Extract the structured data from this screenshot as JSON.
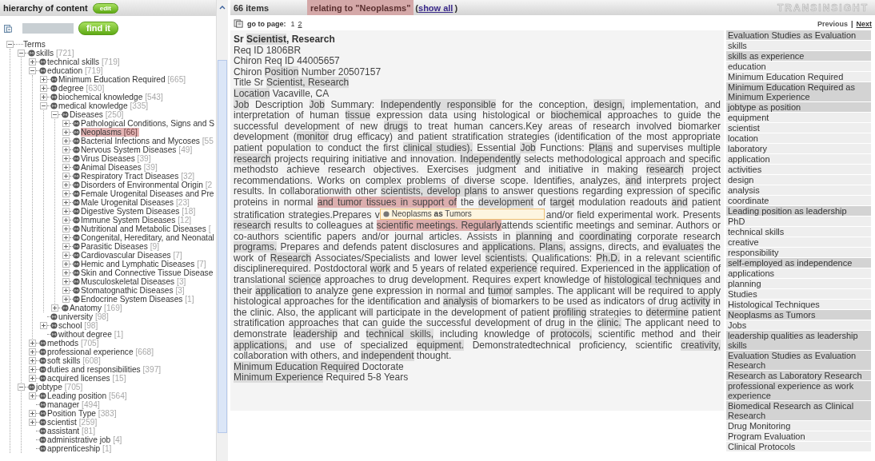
{
  "tree_panel": {
    "title": "hierarchy of content",
    "edit_button": "edit",
    "find_button": "find it"
  },
  "tree": {
    "root": {
      "label": "Terms",
      "expanded": true,
      "children": [
        {
          "label": "skills",
          "count": "[721]",
          "expanded": true,
          "selected": false,
          "children": [
            {
              "label": "technical skills",
              "count": "[719]",
              "expanded": false,
              "selected": false
            },
            {
              "label": "education",
              "count": "[719]",
              "expanded": true,
              "selected": false,
              "children": [
                {
                  "label": "Minimum Education Required",
                  "count": "[665]",
                  "expanded": false,
                  "selected": false
                },
                {
                  "label": "degree",
                  "count": "[630]",
                  "expanded": false,
                  "selected": false
                },
                {
                  "label": "biochemical knowledge",
                  "count": "[543]",
                  "expanded": false,
                  "selected": false
                },
                {
                  "label": "medical knowledge",
                  "count": "[335]",
                  "expanded": true,
                  "selected": false,
                  "children": [
                    {
                      "label": "Diseases",
                      "count": "[250]",
                      "expanded": true,
                      "selected": false,
                      "children": [
                        {
                          "label": "Pathological Conditions, Signs and S",
                          "expanded": false,
                          "selected": false
                        },
                        {
                          "label": "Neoplasms",
                          "count": "[66]",
                          "expanded": false,
                          "selected": true
                        },
                        {
                          "label": "Bacterial Infections and Mycoses",
                          "count": "[55",
                          "expanded": false,
                          "selected": false
                        },
                        {
                          "label": "Nervous System Diseases",
                          "count": "[49]",
                          "expanded": false,
                          "selected": false
                        },
                        {
                          "label": "Virus Diseases",
                          "count": "[39]",
                          "expanded": false,
                          "selected": false
                        },
                        {
                          "label": "Animal Diseases",
                          "count": "[39]",
                          "expanded": false,
                          "selected": false
                        },
                        {
                          "label": "Respiratory Tract Diseases",
                          "count": "[32]",
                          "expanded": false,
                          "selected": false
                        },
                        {
                          "label": "Disorders of Environmental Origin",
                          "count": "[2",
                          "expanded": false,
                          "selected": false
                        },
                        {
                          "label": "Female Urogenital Diseases and Pre",
                          "expanded": false,
                          "selected": false
                        },
                        {
                          "label": "Male Urogenital Diseases",
                          "count": "[23]",
                          "expanded": false,
                          "selected": false
                        },
                        {
                          "label": "Digestive System Diseases",
                          "count": "[18]",
                          "expanded": false,
                          "selected": false
                        },
                        {
                          "label": "Immune System Diseases",
                          "count": "[12]",
                          "expanded": false,
                          "selected": false
                        },
                        {
                          "label": "Nutritional and Metabolic Diseases",
                          "count": "[",
                          "expanded": false,
                          "selected": false
                        },
                        {
                          "label": "Congenital, Hereditary, and Neonatal",
                          "expanded": false,
                          "selected": false
                        },
                        {
                          "label": "Parasitic Diseases",
                          "count": "[9]",
                          "expanded": false,
                          "selected": false
                        },
                        {
                          "label": "Cardiovascular Diseases",
                          "count": "[7]",
                          "expanded": false,
                          "selected": false
                        },
                        {
                          "label": "Hemic and Lymphatic Diseases",
                          "count": "[7]",
                          "expanded": false,
                          "selected": false
                        },
                        {
                          "label": "Skin and Connective Tissue Disease",
                          "expanded": false,
                          "selected": false
                        },
                        {
                          "label": "Musculoskeletal Diseases",
                          "count": "[3]",
                          "expanded": false,
                          "selected": false
                        },
                        {
                          "label": "Stomatognathic Diseases",
                          "count": "[3]",
                          "expanded": false,
                          "selected": false
                        },
                        {
                          "label": "Endocrine System Diseases",
                          "count": "[1]",
                          "expanded": false,
                          "selected": false
                        }
                      ]
                    },
                    {
                      "label": "Anatomy",
                      "count": "[169]",
                      "expanded": false,
                      "selected": false
                    }
                  ]
                },
                {
                  "label": "university",
                  "count": "[98]",
                  "selected": false
                },
                {
                  "label": "school",
                  "count": "[98]",
                  "expanded": false,
                  "selected": false
                },
                {
                  "label": "without degree",
                  "count": "[1]",
                  "selected": false
                }
              ]
            },
            {
              "label": "methods",
              "count": "[705]",
              "expanded": false,
              "selected": false
            },
            {
              "label": "professional experience",
              "count": "[668]",
              "expanded": false,
              "selected": false
            },
            {
              "label": "soft skills",
              "count": "[608]",
              "expanded": false,
              "selected": false
            },
            {
              "label": "duties and responsibilities",
              "count": "[397]",
              "expanded": false,
              "selected": false
            },
            {
              "label": "acquired licenses",
              "count": "[15]",
              "expanded": false,
              "selected": false
            }
          ]
        },
        {
          "label": "jobtype",
          "count": "[705]",
          "expanded": true,
          "selected": false,
          "children": [
            {
              "label": "Leading position",
              "count": "[564]",
              "expanded": false,
              "selected": false
            },
            {
              "label": "manager",
              "count": "[494]",
              "selected": false
            },
            {
              "label": "Position Type",
              "count": "[383]",
              "expanded": false,
              "selected": false
            },
            {
              "label": "scientist",
              "count": "[259]",
              "expanded": false,
              "selected": false
            },
            {
              "label": "assistant",
              "count": "[81]",
              "selected": false
            },
            {
              "label": "administrative job",
              "count": "[4]",
              "selected": false
            },
            {
              "label": "apprenticeship",
              "count": "[1]",
              "selected": false
            }
          ]
        }
      ]
    }
  },
  "results": {
    "count": "66 items",
    "filter": "relating to \"Neoplasms\"",
    "show_all_open": "(",
    "show_all": "show all",
    "show_all_close": ")",
    "logo": "TRANSINSIGHT"
  },
  "pager": {
    "label": "go to page:",
    "pages": [
      {
        "label": "1",
        "selected": true
      },
      {
        "label": "2",
        "selected": false
      }
    ],
    "previous": {
      "label": "Previous",
      "disabled": true
    },
    "separator": "|",
    "next": {
      "label": "Next",
      "disabled": false
    }
  },
  "document": {
    "lines": [
      {
        "kind": "title",
        "segments": [
          {
            "text": "Sr ",
            "kind": "plain"
          },
          {
            "text": "Scientist",
            "kind": "term"
          },
          {
            "text": ", Research",
            "kind": "plain"
          }
        ]
      },
      {
        "kind": "text",
        "segments": [
          {
            "text": "Req ID 1806BR",
            "kind": "plain"
          }
        ]
      },
      {
        "kind": "text",
        "segments": [
          {
            "text": "Chiron Req ID 44005657",
            "kind": "plain"
          }
        ]
      },
      {
        "kind": "text",
        "segments": [
          {
            "text": "Chiron ",
            "kind": "plain"
          },
          {
            "text": "Position",
            "kind": "term"
          },
          {
            "text": " Number 20507157",
            "kind": "plain"
          }
        ]
      },
      {
        "kind": "text",
        "segments": [
          {
            "text": "Title Sr ",
            "kind": "plain"
          },
          {
            "text": "Scientist, ",
            "kind": "term"
          },
          {
            "text": "Research",
            "kind": "term"
          }
        ]
      },
      {
        "kind": "text",
        "segments": [
          {
            "text": "Location",
            "kind": "term"
          },
          {
            "text": " Vacaville, CA",
            "kind": "plain"
          }
        ]
      }
    ],
    "description": [
      {
        "text": "Job",
        "kind": "term"
      },
      {
        "text": " Description ",
        "kind": "plain"
      },
      {
        "text": "Job",
        "kind": "term"
      },
      {
        "text": " Summary: ",
        "kind": "plain"
      },
      {
        "text": "Independently ",
        "kind": "term"
      },
      {
        "text": "responsible",
        "kind": "term"
      },
      {
        "text": " for the conception, ",
        "kind": "plain"
      },
      {
        "text": "design,",
        "kind": "term"
      },
      {
        "text": " implementation, and interpretation of human ",
        "kind": "plain"
      },
      {
        "text": "tissue",
        "kind": "term"
      },
      {
        "text": " expression data using histological or ",
        "kind": "plain"
      },
      {
        "text": "biochemical",
        "kind": "term"
      },
      {
        "text": " approaches to guide the successful development of new ",
        "kind": "plain"
      },
      {
        "text": "drugs",
        "kind": "term"
      },
      {
        "text": " to treat human cancers.Key areas of research involved biomarker development (",
        "kind": "plain"
      },
      {
        "text": "monitor",
        "kind": "term"
      },
      {
        "text": " drug efficacy) and patient stratification strategies (identification of the most appropriate patient population to conduct the first ",
        "kind": "plain"
      },
      {
        "text": "clinical studies).",
        "kind": "term"
      },
      {
        "text": " Essential ",
        "kind": "plain"
      },
      {
        "text": "Job",
        "kind": "term"
      },
      {
        "text": " Functions: ",
        "kind": "plain"
      },
      {
        "text": "Plans",
        "kind": "term"
      },
      {
        "text": " and supervises multiple ",
        "kind": "plain"
      },
      {
        "text": "research",
        "kind": "term"
      },
      {
        "text": " projects requiring initiative and innovation. ",
        "kind": "plain"
      },
      {
        "text": "Independently",
        "kind": "term"
      },
      {
        "text": " selects methodological approach and specific methodsto achieve research objectives. Exercises judgment and initiative in making ",
        "kind": "plain"
      },
      {
        "text": "research",
        "kind": "term"
      },
      {
        "text": " project recommendations. Works on complex problems of diverse scope. Identifies, analyzes, ",
        "kind": "plain"
      },
      {
        "text": "and",
        "kind": "term"
      },
      {
        "text": " interprets project results. In collaborationwith other ",
        "kind": "plain"
      },
      {
        "text": "scientists, ",
        "kind": "term"
      },
      {
        "text": "develop ",
        "kind": "term"
      },
      {
        "text": "plans",
        "kind": "term"
      },
      {
        "text": " to answer questions regarding expression of specific proteins in normal ",
        "kind": "plain"
      },
      {
        "text": "and tumor tissues in support of",
        "kind": "hit"
      },
      {
        "text": " the ",
        "kind": "plain"
      },
      {
        "text": "development",
        "kind": "term"
      },
      {
        "text": " of ",
        "kind": "plain"
      },
      {
        "text": "target",
        "kind": "term"
      },
      {
        "text": " modulation readouts ",
        "kind": "plain"
      },
      {
        "text": "and",
        "kind": "term"
      },
      {
        "text": " patient stratification strategies.Prepares v",
        "kind": "plain"
      }
    ],
    "tooltip": {
      "text": "Neoplasms **as** Tumors"
    },
    "description_rest": [
      {
        "text": "and/or field experimental work. Presents ",
        "kind": "plain"
      },
      {
        "text": "research",
        "kind": "term"
      },
      {
        "text": " results to colleagues at ",
        "kind": "plain"
      },
      {
        "text": "scientific meetings. Regularly",
        "kind": "hit"
      },
      {
        "text": "attends scientific meetings and seminar. Authors or co-authors scientific papers and/or journal articles. Assists in ",
        "kind": "plain"
      },
      {
        "text": "planning",
        "kind": "term"
      },
      {
        "text": " and ",
        "kind": "plain"
      },
      {
        "text": "coordinating",
        "kind": "term"
      },
      {
        "text": " corporate research ",
        "kind": "plain"
      },
      {
        "text": "programs.",
        "kind": "term"
      },
      {
        "text": " Prepares and defends patent disclosures and ",
        "kind": "plain"
      },
      {
        "text": "applications. ",
        "kind": "term"
      },
      {
        "text": "Plans,",
        "kind": "term"
      },
      {
        "text": " assigns, directs, and ",
        "kind": "plain"
      },
      {
        "text": "evaluates",
        "kind": "term"
      },
      {
        "text": " the work of ",
        "kind": "plain"
      },
      {
        "text": "Research",
        "kind": "term"
      },
      {
        "text": " Associates/Specialists and lower level ",
        "kind": "plain"
      },
      {
        "text": "scientists.",
        "kind": "term"
      },
      {
        "text": " Qualifications: ",
        "kind": "plain"
      },
      {
        "text": "Ph.D.",
        "kind": "term"
      },
      {
        "text": " in a relevant scientific disciplinerequired. Postdoctoral ",
        "kind": "plain"
      },
      {
        "text": "work",
        "kind": "term"
      },
      {
        "text": " and 5 years of related ",
        "kind": "plain"
      },
      {
        "text": "experience",
        "kind": "term"
      },
      {
        "text": " required. Experienced in the ",
        "kind": "plain"
      },
      {
        "text": "application",
        "kind": "term"
      },
      {
        "text": " of translational ",
        "kind": "plain"
      },
      {
        "text": "science",
        "kind": "term"
      },
      {
        "text": " approaches to drug development. Requires expert knowledge of ",
        "kind": "plain"
      },
      {
        "text": "histological techniques",
        "kind": "term"
      },
      {
        "text": " and their ",
        "kind": "plain"
      },
      {
        "text": "application",
        "kind": "term"
      },
      {
        "text": " to analyze gene expression in normal and ",
        "kind": "plain"
      },
      {
        "text": "tumor",
        "kind": "term"
      },
      {
        "text": " samples. The applicant will be required to apply histological approaches for the identification and ",
        "kind": "plain"
      },
      {
        "text": "analysis",
        "kind": "term"
      },
      {
        "text": " of biomarkers to be used as indicators of drug ",
        "kind": "plain"
      },
      {
        "text": "activity",
        "kind": "term"
      },
      {
        "text": " in the clinic. Also, the applicant will participate in the development of patient ",
        "kind": "plain"
      },
      {
        "text": "profiling",
        "kind": "term"
      },
      {
        "text": " strategies to ",
        "kind": "plain"
      },
      {
        "text": "determine",
        "kind": "term"
      },
      {
        "text": " patient stratification approaches that can guide the successful development of drug in the ",
        "kind": "plain"
      },
      {
        "text": "clinic.",
        "kind": "term"
      },
      {
        "text": " The applicant need to demonstrate ",
        "kind": "plain"
      },
      {
        "text": "leadership",
        "kind": "term"
      },
      {
        "text": " and ",
        "kind": "plain"
      },
      {
        "text": "technical ",
        "kind": "term"
      },
      {
        "text": "skills,",
        "kind": "term"
      },
      {
        "text": " including knowledge of ",
        "kind": "plain"
      },
      {
        "text": "protocols,",
        "kind": "term"
      },
      {
        "text": " scientific method and their ",
        "kind": "plain"
      },
      {
        "text": "applications,",
        "kind": "term"
      },
      {
        "text": " and use of specialized ",
        "kind": "plain"
      },
      {
        "text": "equipment.",
        "kind": "term"
      },
      {
        "text": " Demonstratedtechnical proficiency, scientific ",
        "kind": "plain"
      },
      {
        "text": "creativity,",
        "kind": "term"
      },
      {
        "text": " collaboration with others, and ",
        "kind": "plain"
      },
      {
        "text": "independent",
        "kind": "term"
      },
      {
        "text": " thought.",
        "kind": "plain"
      }
    ],
    "footer_lines": [
      {
        "kind": "text",
        "segments": [
          {
            "text": "Minimum ",
            "kind": "term"
          },
          {
            "text": "Education ",
            "kind": "term"
          },
          {
            "text": "Required",
            "kind": "term"
          },
          {
            "text": " Doctorate",
            "kind": "plain"
          }
        ]
      },
      {
        "kind": "text",
        "segments": [
          {
            "text": "Minimum ",
            "kind": "term"
          },
          {
            "text": "Experience",
            "kind": "term"
          },
          {
            "text": " Required 5-8 Years",
            "kind": "plain"
          }
        ]
      }
    ]
  },
  "concepts": [
    {
      "label": "Evaluation Studies as Evaluation",
      "kind": "synonym"
    },
    {
      "label": "skills",
      "kind": "term"
    },
    {
      "label": "skills as experience",
      "kind": "synonym"
    },
    {
      "label": "education",
      "kind": "term"
    },
    {
      "label": "Minimum Education Required",
      "kind": "term"
    },
    {
      "label": "Minimum Education Required as Minimum Experience",
      "kind": "synonym"
    },
    {
      "label": "jobtype as position",
      "kind": "synonym"
    },
    {
      "label": "equipment",
      "kind": "term"
    },
    {
      "label": "scientist",
      "kind": "term"
    },
    {
      "label": "location",
      "kind": "term"
    },
    {
      "label": "laboratory",
      "kind": "term"
    },
    {
      "label": "application",
      "kind": "term"
    },
    {
      "label": "activities",
      "kind": "term"
    },
    {
      "label": "design",
      "kind": "term"
    },
    {
      "label": "analysis",
      "kind": "term"
    },
    {
      "label": "coordinate",
      "kind": "term"
    },
    {
      "label": "Leading position as leadership",
      "kind": "synonym"
    },
    {
      "label": "PhD",
      "kind": "term"
    },
    {
      "label": "technical skills",
      "kind": "term"
    },
    {
      "label": "creative",
      "kind": "term"
    },
    {
      "label": "responsibility",
      "kind": "term"
    },
    {
      "label": "self-employed as independence",
      "kind": "synonym"
    },
    {
      "label": "applications",
      "kind": "term"
    },
    {
      "label": "planning",
      "kind": "term"
    },
    {
      "label": "Studies",
      "kind": "term"
    },
    {
      "label": "Histological Techniques",
      "kind": "term"
    },
    {
      "label": "Neoplasms as Tumors",
      "kind": "synonym"
    },
    {
      "label": "Jobs",
      "kind": "term"
    },
    {
      "label": "leadership qualities as leadership skills",
      "kind": "synonym"
    },
    {
      "label": "Evaluation Studies as Evaluation Research",
      "kind": "synonym"
    },
    {
      "label": "Research as Laboratory Research",
      "kind": "synonym"
    },
    {
      "label": "professional experience as work experience",
      "kind": "synonym"
    },
    {
      "label": "Biomedical Research as Clinical Research",
      "kind": "synonym"
    },
    {
      "label": "Drug Monitoring",
      "kind": "term"
    },
    {
      "label": "Program Evaluation",
      "kind": "term"
    },
    {
      "label": "Clinical Protocols",
      "kind": "term"
    }
  ]
}
